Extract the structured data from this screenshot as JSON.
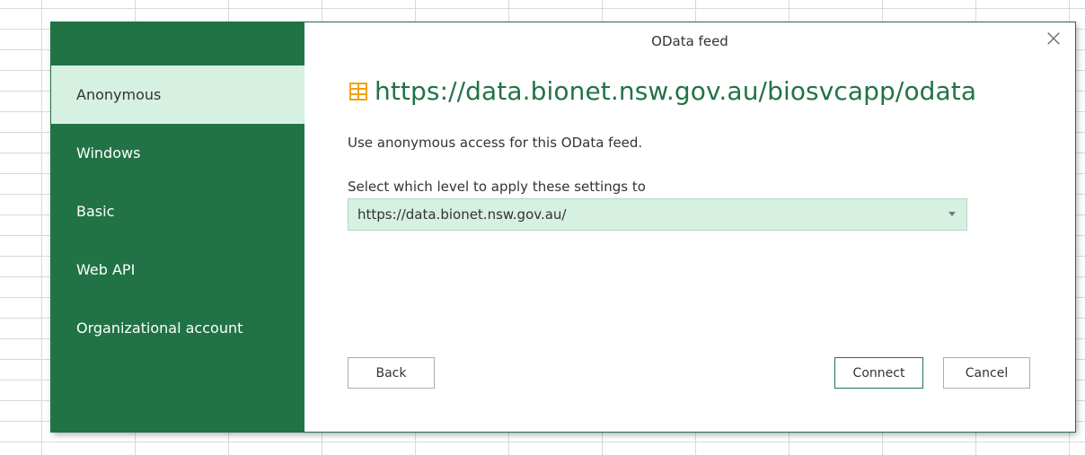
{
  "dialog": {
    "title": "OData feed",
    "close_label": "×",
    "url": "https://data.bionet.nsw.gov.au/biosvcapp/odata",
    "description": "Use anonymous access for this OData feed.",
    "level_label": "Select which level to apply these settings to",
    "level_value": "https://data.bionet.nsw.gov.au/",
    "icons": {
      "feed": "odata-table-icon",
      "close": "close-icon",
      "dropdown": "chevron-down-icon"
    }
  },
  "sidebar": {
    "items": [
      {
        "label": "Anonymous",
        "active": true
      },
      {
        "label": "Windows",
        "active": false
      },
      {
        "label": "Basic",
        "active": false
      },
      {
        "label": "Web API",
        "active": false
      },
      {
        "label": "Organizational account",
        "active": false
      }
    ]
  },
  "buttons": {
    "back": "Back",
    "connect": "Connect",
    "cancel": "Cancel"
  },
  "colors": {
    "sidebar": "#217346",
    "active_item": "#d6f0e2",
    "url_text": "#217346",
    "feed_icon": "#f0a30a"
  }
}
